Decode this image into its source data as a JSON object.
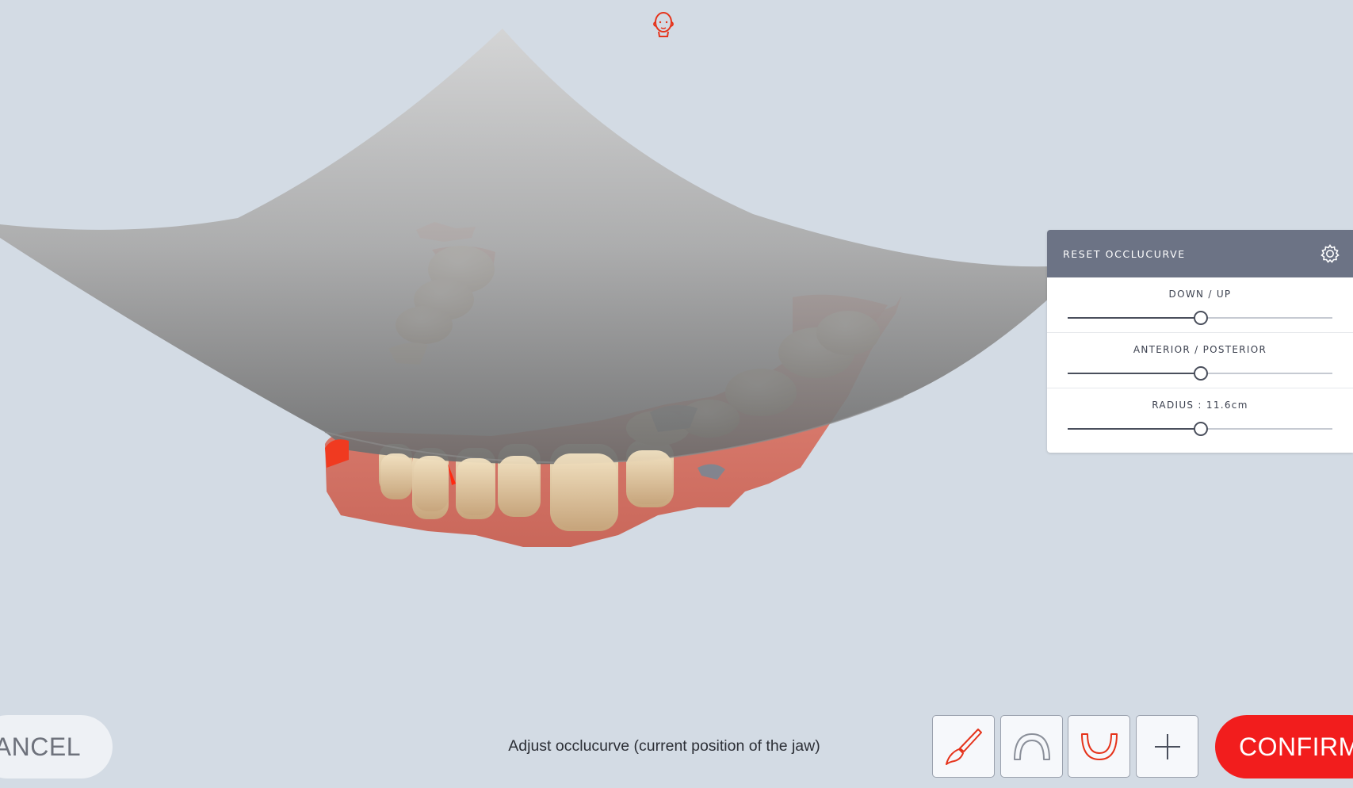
{
  "header": {
    "head_icon": "head-orientation-icon"
  },
  "panel": {
    "title": "RESET OCCLUCURVE",
    "settings_icon": "gear-icon",
    "sliders": [
      {
        "label": "DOWN / UP",
        "value_fraction": 0.5
      },
      {
        "label": "ANTERIOR / POSTERIOR",
        "value_fraction": 0.5
      },
      {
        "label": "RADIUS : 11.6cm",
        "value_fraction": 0.5
      }
    ]
  },
  "footer": {
    "cancel_label": "CANCEL",
    "status_message": "Adjust occlucurve (current position of the jaw)",
    "tools": [
      {
        "name": "brush-tool",
        "icon": "brush-icon"
      },
      {
        "name": "upper-arch-tool",
        "icon": "upper-arch-icon"
      },
      {
        "name": "lower-arch-tool",
        "icon": "lower-arch-icon"
      },
      {
        "name": "crosshair-tool",
        "icon": "crosshair-icon"
      }
    ],
    "confirm_label": "CONFIRM"
  },
  "colors": {
    "background": "#d3dbe4",
    "accent": "#f21d1d",
    "panel_header": "#6c7385",
    "gum": "#d9786a",
    "tooth": "#e8d4ac"
  }
}
